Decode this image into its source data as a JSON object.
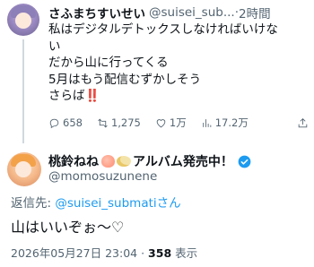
{
  "tweet1": {
    "display_name": "さふまちすいせい",
    "handle": "@suisei_sub...",
    "separator": " · ",
    "time": "2時間",
    "lines": [
      "私はデジタルデトックスしなければいけな",
      "い",
      "だから山に行ってくる",
      "5月はもう配信むずかしそう",
      "さらば"
    ],
    "emphasis": "‼️",
    "actions": {
      "replies": "658",
      "retweets": "1,275",
      "likes": "1万",
      "views": "17.2万"
    }
  },
  "tweet2": {
    "display_name": "桃鈴ねね",
    "name_suffix": "アルバム発売中！",
    "handle": "@momosuzunene",
    "reply_prefix": "返信先: ",
    "reply_mention": "@suisei_submatiさん",
    "text": "山はいいぞぉ〜♡",
    "timestamp": "2026年05月27日 23:04 · ",
    "views_count": "358",
    "views_label": " 表示"
  },
  "colors": {
    "accent": "#1d9bf0",
    "secondary_text": "#536471",
    "primary_text": "#0f1419"
  },
  "icons": [
    "reply-icon",
    "retweet-icon",
    "like-icon",
    "views-icon",
    "share-icon",
    "verified-badge-icon"
  ]
}
